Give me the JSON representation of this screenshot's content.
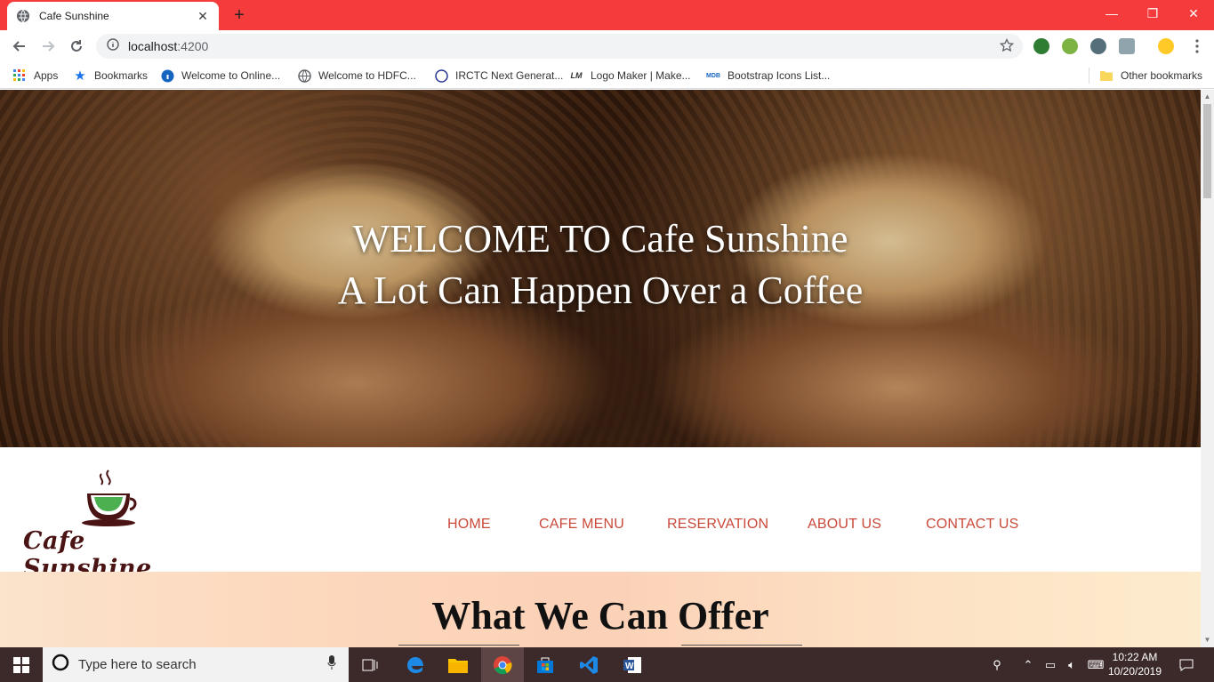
{
  "browser": {
    "tab_title": "Cafe Sunshine",
    "url_host": "localhost",
    "url_port": ":4200",
    "bookmarks": [
      {
        "label": "Apps",
        "icon": "apps-grid-icon"
      },
      {
        "label": "Bookmarks",
        "icon": "star-icon"
      },
      {
        "label": "Welcome to Online...",
        "icon": "info-icon"
      },
      {
        "label": "Welcome to HDFC...",
        "icon": "globe-icon"
      },
      {
        "label": "IRCTC Next Generat...",
        "icon": "irctc-icon"
      },
      {
        "label": "Logo Maker | Make...",
        "icon": "lm-icon"
      },
      {
        "label": "Bootstrap Icons List...",
        "icon": "mdb-icon"
      }
    ],
    "other_bookmarks": "Other bookmarks"
  },
  "hero": {
    "line1": "WELCOME TO Cafe Sunshine",
    "line2": "A Lot Can Happen Over a Coffee"
  },
  "nav": {
    "logo_text": "Cafe Sunshine",
    "items": [
      "HOME",
      "CAFE MENU",
      "RESERVATION",
      "ABOUT US",
      "CONTACT US"
    ]
  },
  "offer": {
    "title": "What We Can Offer"
  },
  "taskbar": {
    "search_placeholder": "Type here to search",
    "time": "10:22 AM",
    "date": "10/20/2019"
  },
  "colors": {
    "tabstrip": "#f53b3b",
    "nav_link": "#c9493a",
    "logo_text": "#4a1414",
    "taskbar": "#3c2a2a"
  }
}
